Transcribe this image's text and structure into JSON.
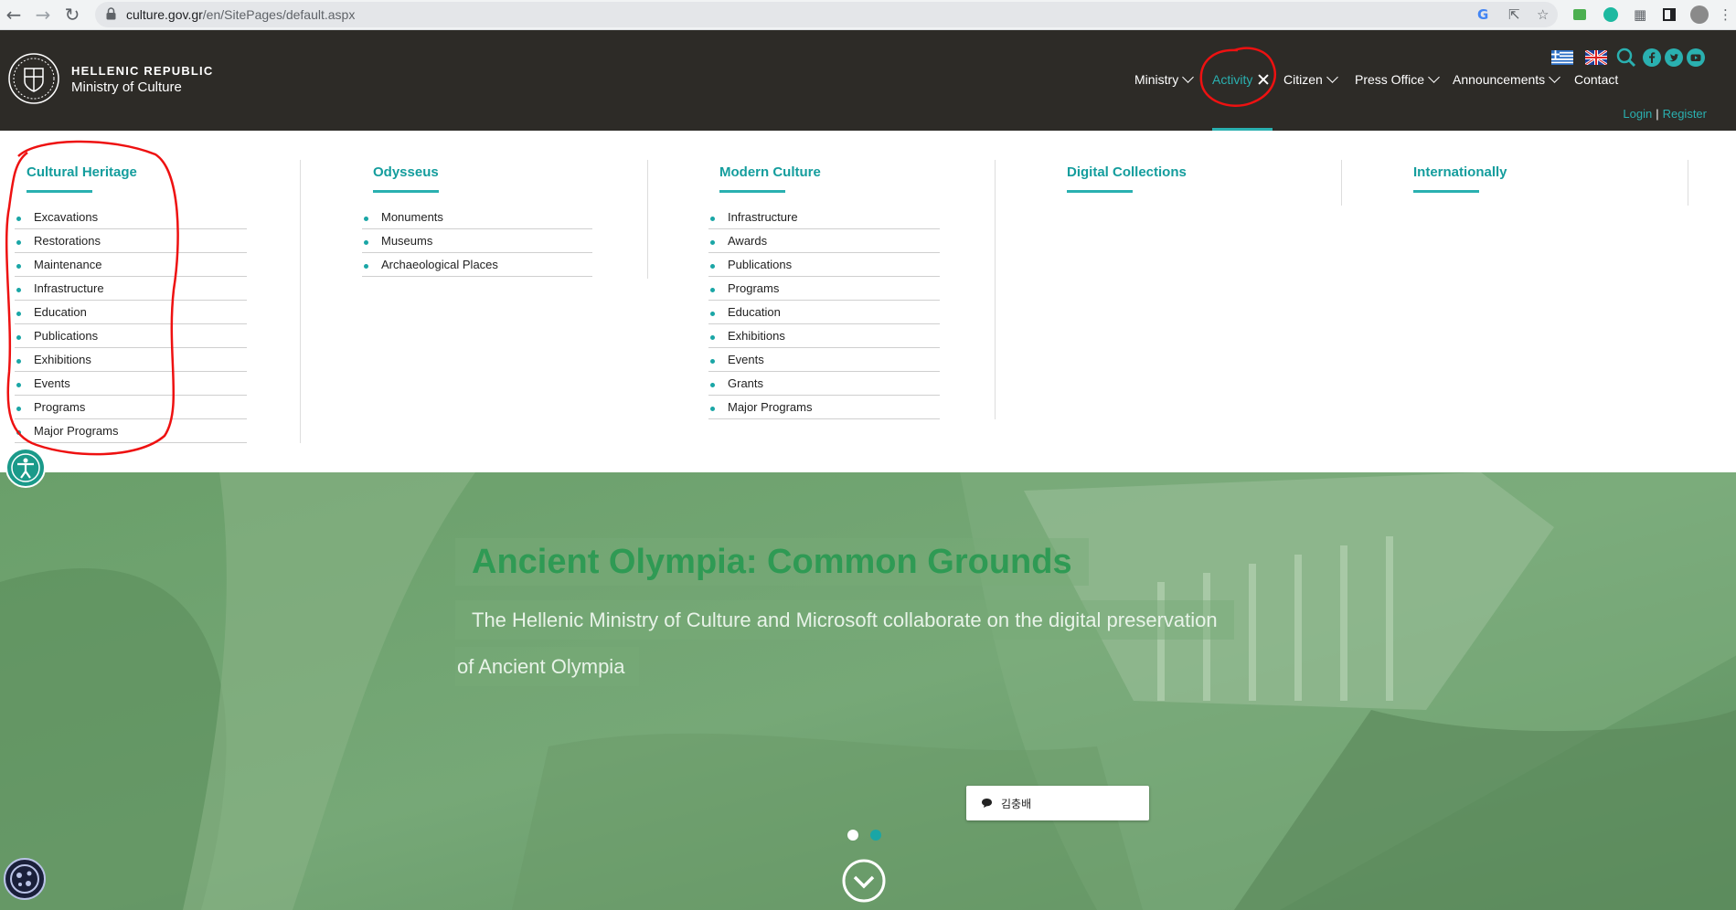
{
  "browser": {
    "url_host": "culture.gov.gr",
    "url_path": "/en/SitePages/default.aspx"
  },
  "header": {
    "brand_line1": "HELLENIC REPUBLIC",
    "brand_line2": "Ministry of Culture",
    "nav": {
      "ministry": "Ministry",
      "activity": "Activity",
      "citizen": "Citizen",
      "press_office": "Press Office",
      "announcements": "Announcements",
      "contact": "Contact"
    },
    "login": "Login",
    "separator": "|",
    "register": "Register",
    "colors": {
      "background": "#2d2b27",
      "accent": "#2ab0b0"
    }
  },
  "mega_menu": {
    "columns": [
      {
        "title": "Cultural Heritage",
        "items": [
          "Excavations",
          "Restorations",
          "Maintenance",
          "Infrastructure",
          "Education",
          "Publications",
          "Exhibitions",
          "Events",
          "Programs",
          "Major Programs"
        ]
      },
      {
        "title": "Odysseus",
        "items": [
          "Monuments",
          "Museums",
          "Archaeological Places"
        ]
      },
      {
        "title": "Modern Culture",
        "items": [
          "Infrastructure",
          "Awards",
          "Publications",
          "Programs",
          "Education",
          "Exhibitions",
          "Events",
          "Grants",
          "Major Programs"
        ]
      },
      {
        "title": "Digital Collections",
        "items": []
      },
      {
        "title": "Internationally",
        "items": []
      }
    ]
  },
  "hero": {
    "title": "Ancient Olympia: Common Grounds",
    "subtitle_line1": "The Hellenic Ministry of Culture and Microsoft collaborate on the digital preservation",
    "subtitle_line2": "of Ancient Olympia",
    "chat_label": "김충배",
    "slide_count": 2,
    "active_slide": 2
  }
}
